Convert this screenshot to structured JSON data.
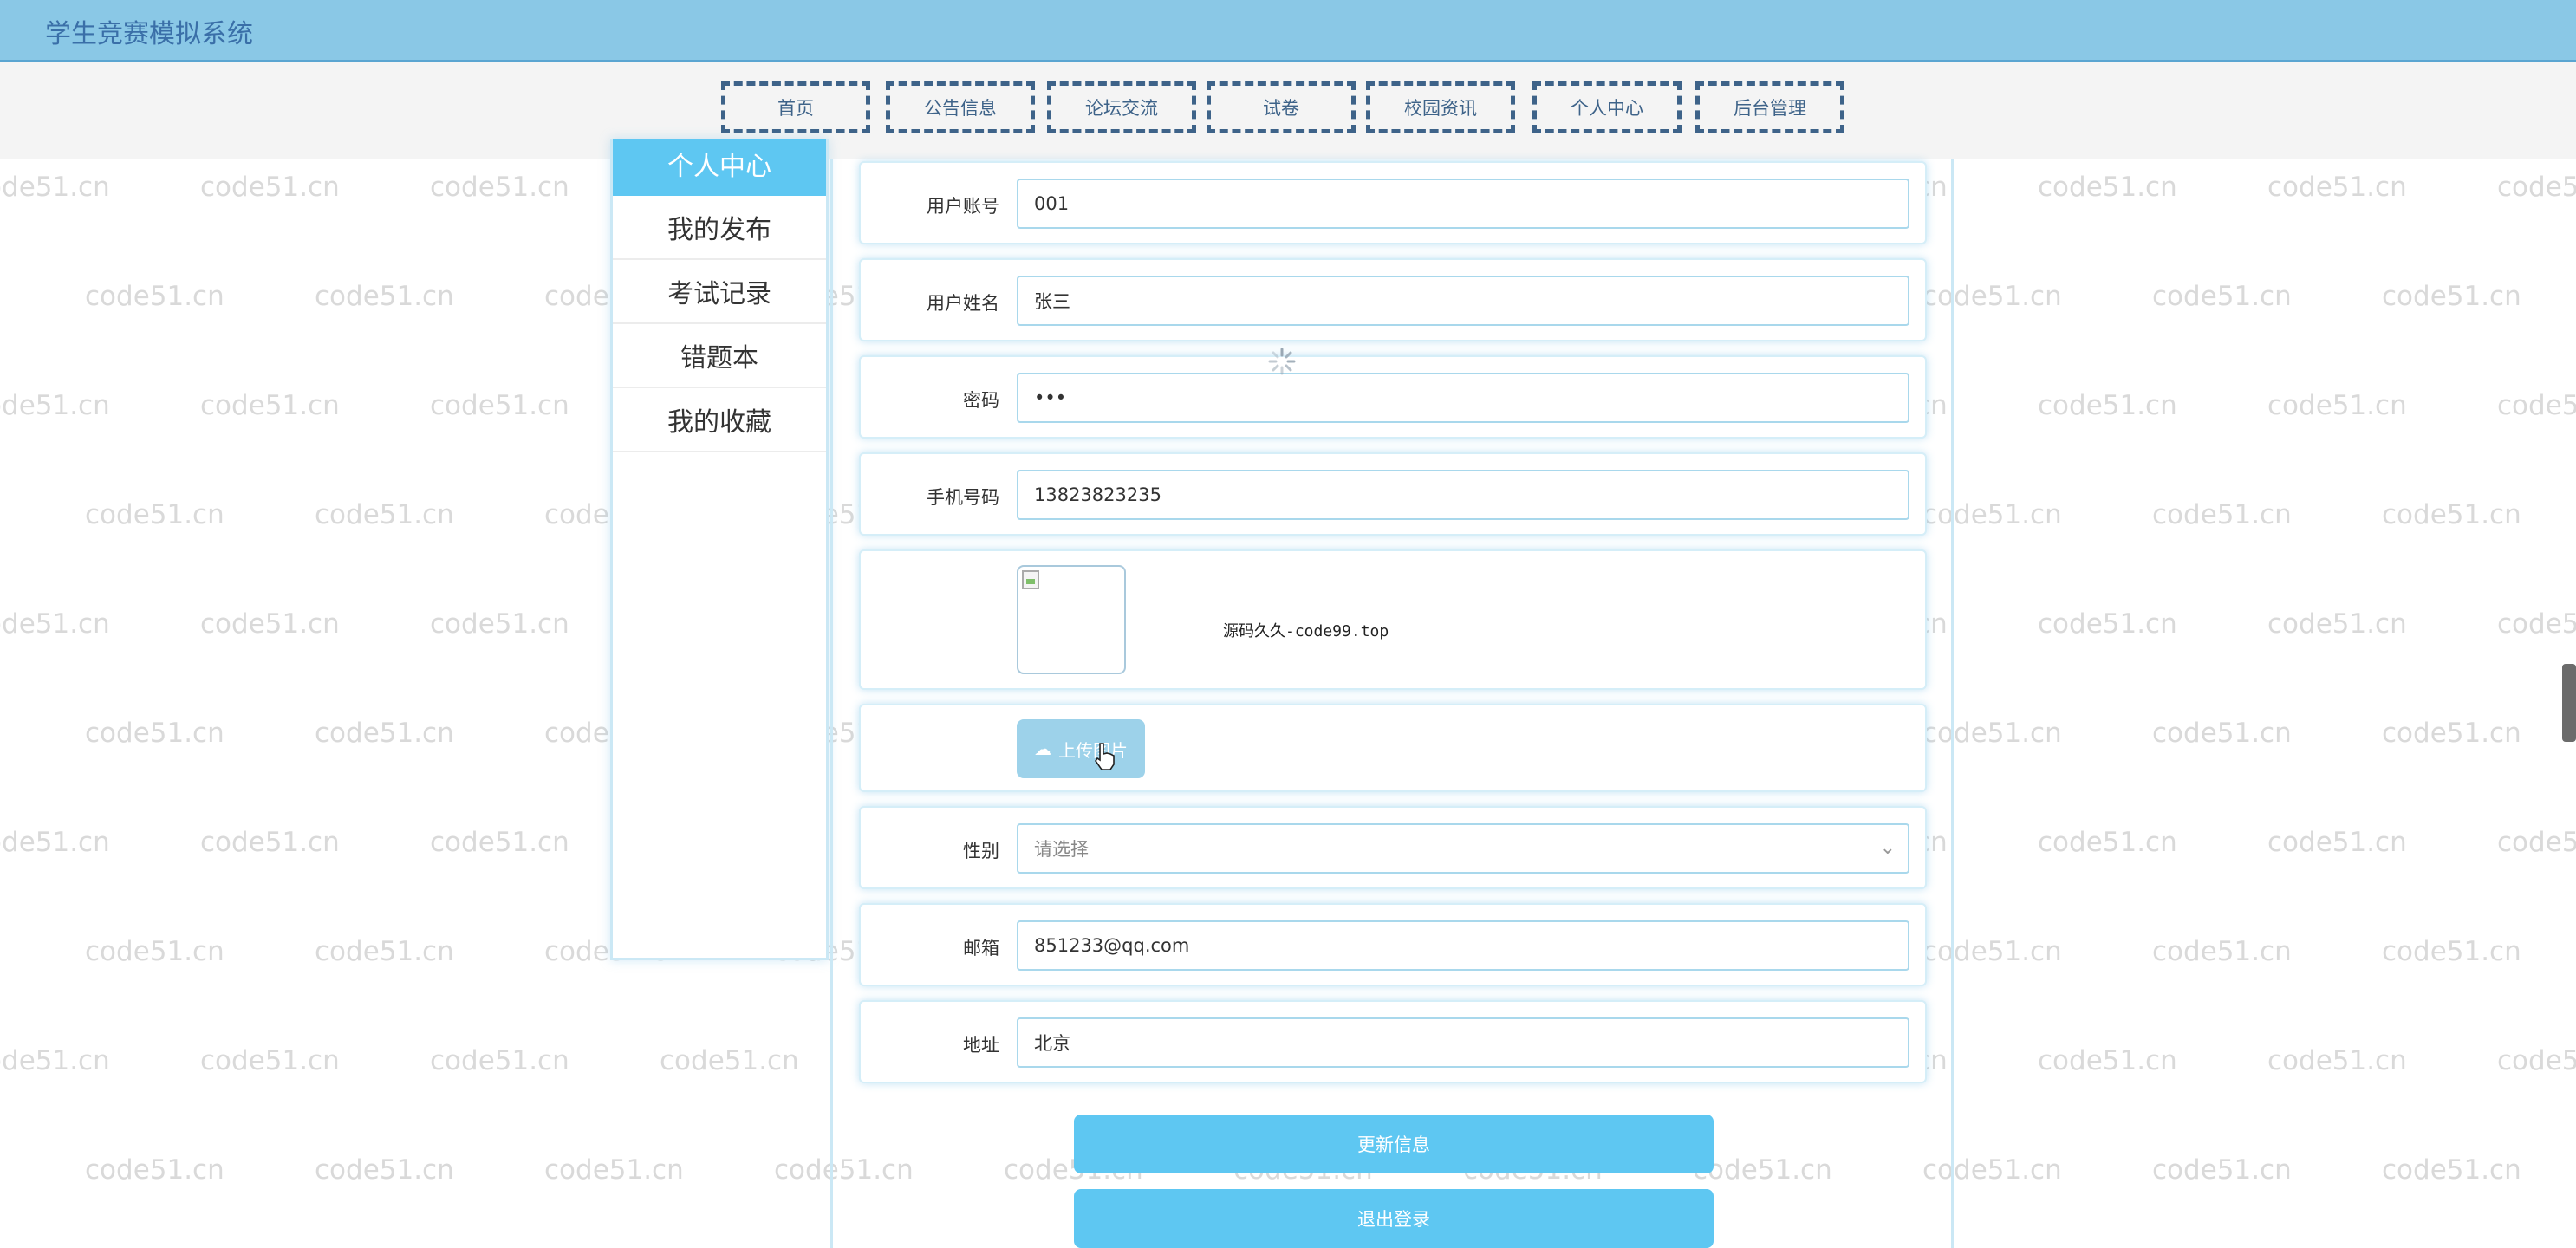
{
  "app": {
    "title": "学生竞赛模拟系统"
  },
  "nav": {
    "items": [
      {
        "label": "首页"
      },
      {
        "label": "公告信息"
      },
      {
        "label": "论坛交流"
      },
      {
        "label": "试卷"
      },
      {
        "label": "校园资讯"
      },
      {
        "label": "个人中心"
      },
      {
        "label": "后台管理"
      }
    ]
  },
  "sidebar": {
    "header": "个人中心",
    "items": [
      {
        "label": "我的发布"
      },
      {
        "label": "考试记录"
      },
      {
        "label": "错题本"
      },
      {
        "label": "我的收藏"
      }
    ]
  },
  "form": {
    "account_label": "用户账号",
    "account_value": "001",
    "name_label": "用户姓名",
    "name_value": "张三",
    "password_label": "密码",
    "password_value": "•••",
    "phone_label": "手机号码",
    "phone_value": "13823823235",
    "avatar_caption": "源码久久-code99.top",
    "upload_label": "上传图片",
    "gender_label": "性别",
    "gender_placeholder": "请选择",
    "email_label": "邮箱",
    "email_value": "851233@qq.com",
    "address_label": "地址",
    "address_value": "北京",
    "update_button": "更新信息",
    "logout_button": "退出登录"
  },
  "watermark": {
    "text": "code51.cn"
  },
  "icons": {
    "upload": "cloud-upload-icon",
    "select": "chevron-down-icon",
    "spinner": "loading-spinner-icon",
    "cursor": "hand-pointer-icon"
  },
  "colors": {
    "topbar": "#8ac8e6",
    "nav_border": "#3e6389",
    "accent": "#5ec7f2",
    "upload_button": "#9dd2ea"
  }
}
